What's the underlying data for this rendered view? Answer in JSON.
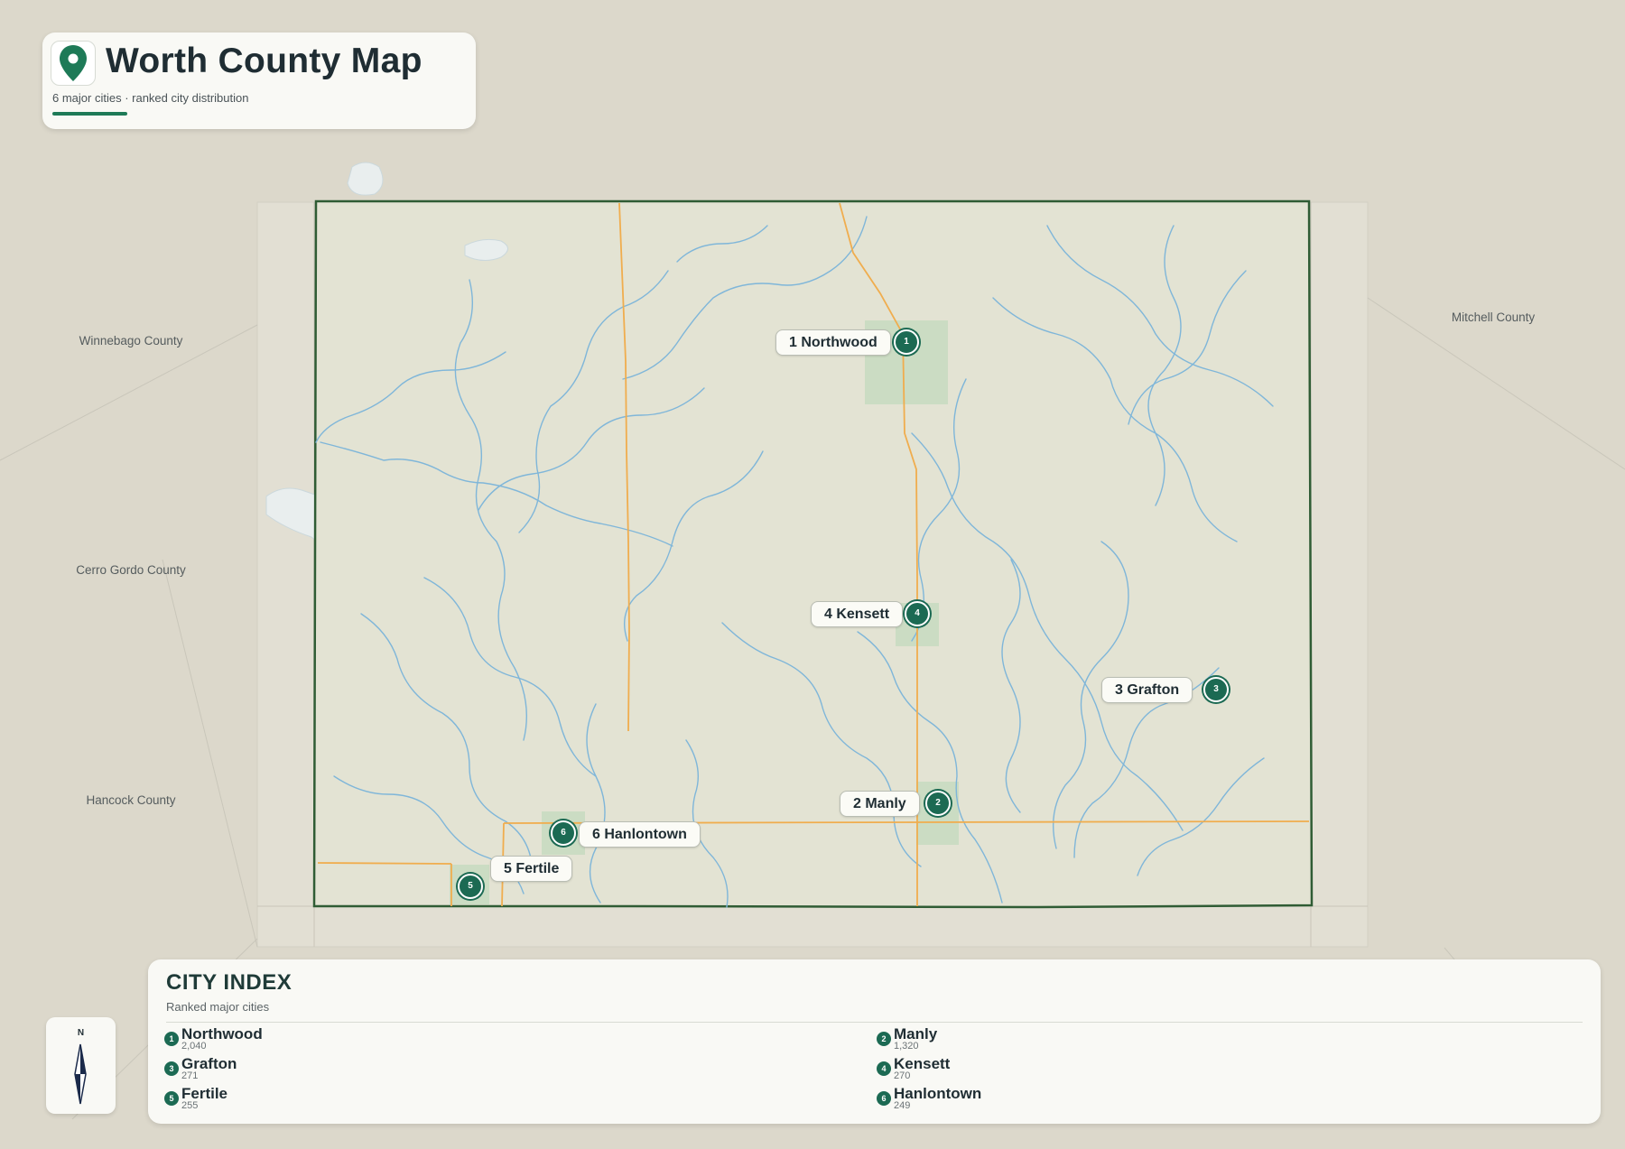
{
  "header": {
    "title": "Worth County Map",
    "subtitle": "6 major cities · ranked city distribution"
  },
  "neighbors": [
    {
      "id": "winnebago",
      "label": "Winnebago County"
    },
    {
      "id": "mitchell",
      "label": "Mitchell County"
    },
    {
      "id": "cerro-gordo",
      "label": "Cerro Gordo County"
    },
    {
      "id": "hancock",
      "label": "Hancock County"
    }
  ],
  "cities": [
    {
      "rank": "1",
      "label": "1 Northwood",
      "name": "Northwood",
      "population": "2,040"
    },
    {
      "rank": "2",
      "label": "2 Manly",
      "name": "Manly",
      "population": "1,320"
    },
    {
      "rank": "3",
      "label": "3 Grafton",
      "name": "Grafton",
      "population": "271"
    },
    {
      "rank": "4",
      "label": "4 Kensett",
      "name": "Kensett",
      "population": "270"
    },
    {
      "rank": "5",
      "label": "5 Fertile",
      "name": "Fertile",
      "population": "255"
    },
    {
      "rank": "6",
      "label": "6 Hanlontown",
      "name": "Hanlontown",
      "population": "249"
    }
  ],
  "compass": {
    "north_label": "N"
  },
  "index": {
    "title": "CITY INDEX",
    "subtitle": "Ranked major cities"
  },
  "colors": {
    "county_border": "#2f5c34",
    "county_fill": "#e3e3d3",
    "river": "#7fb6d9",
    "road": "#f0ad4e",
    "city_area": "#c3d9bd",
    "marker": "#1c6a53"
  }
}
